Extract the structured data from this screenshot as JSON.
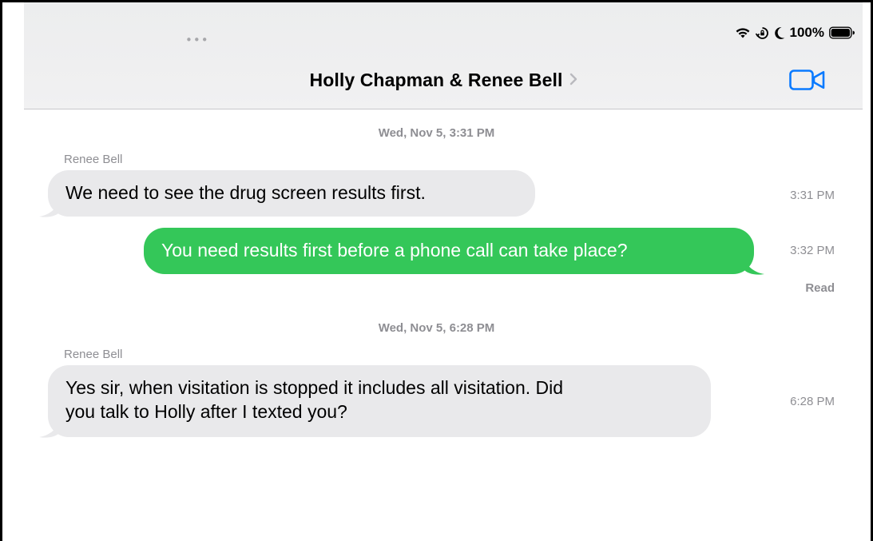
{
  "status_bar": {
    "battery_text": "100%",
    "icons": [
      "wifi-icon",
      "orientation-lock-icon",
      "moon-icon",
      "battery-icon"
    ]
  },
  "header": {
    "multitasking_dots": "•••",
    "conversation_title": "Holly Chapman & Renee Bell",
    "video_call_icon": "video-camera-icon"
  },
  "conversation": {
    "groups": [
      {
        "timestamp": "Wed, Nov 5, 3:31 PM",
        "sender": "Renee Bell",
        "messages": [
          {
            "direction": "incoming",
            "text": "We need to see the drug screen results first.",
            "time": "3:31 PM"
          },
          {
            "direction": "outgoing",
            "text": "You need results first before a phone call can take place?",
            "time": "3:32 PM",
            "receipt": "Read"
          }
        ]
      },
      {
        "timestamp": "Wed, Nov 5, 6:28 PM",
        "sender": "Renee Bell",
        "messages": [
          {
            "direction": "incoming",
            "text_lines": [
              "Yes sir, when visitation is stopped it includes all visitation. Did",
              "you talk to Holly after I texted you?"
            ],
            "time": "6:28 PM"
          }
        ]
      }
    ]
  },
  "colors": {
    "outgoing_bubble": "#34c759",
    "incoming_bubble": "#e9e9eb",
    "accent": "#0a7aff",
    "secondary_text": "#8e8e93"
  }
}
